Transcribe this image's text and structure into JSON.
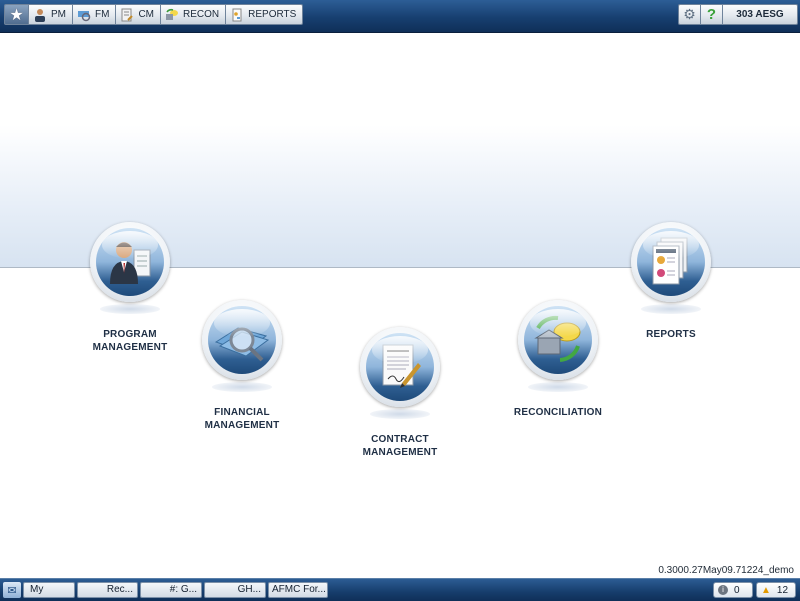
{
  "toolbar": {
    "star": "★",
    "buttons": [
      {
        "label": "PM",
        "icon": "person-icon"
      },
      {
        "label": "FM",
        "icon": "money-icon"
      },
      {
        "label": "CM",
        "icon": "contract-icon"
      },
      {
        "label": "RECON",
        "icon": "recon-icon"
      },
      {
        "label": "REPORTS",
        "icon": "report-icon"
      }
    ],
    "settings_glyph": "⚙",
    "help_glyph": "?",
    "unit": "303 AESG"
  },
  "modules": [
    {
      "label": "PROGRAM\nMANAGEMENT",
      "icon": "manager-icon"
    },
    {
      "label": "FINANCIAL\nMANAGEMENT",
      "icon": "magnifier-money-icon"
    },
    {
      "label": "CONTRACT\nMANAGEMENT",
      "icon": "contract-pen-icon"
    },
    {
      "label": "RECONCILIATION",
      "icon": "recon-cycle-icon"
    },
    {
      "label": "REPORTS",
      "icon": "reports-stack-icon"
    }
  ],
  "version": "0.3000.27May09.71224_demo",
  "taskbar": {
    "start_glyph": "✉",
    "items": [
      "My",
      "Rec...",
      "#: G...",
      "GH...",
      "AFMC For..."
    ],
    "info_count": "0",
    "warning_count": "12",
    "info_glyph": "i",
    "warning_glyph": "▲"
  }
}
